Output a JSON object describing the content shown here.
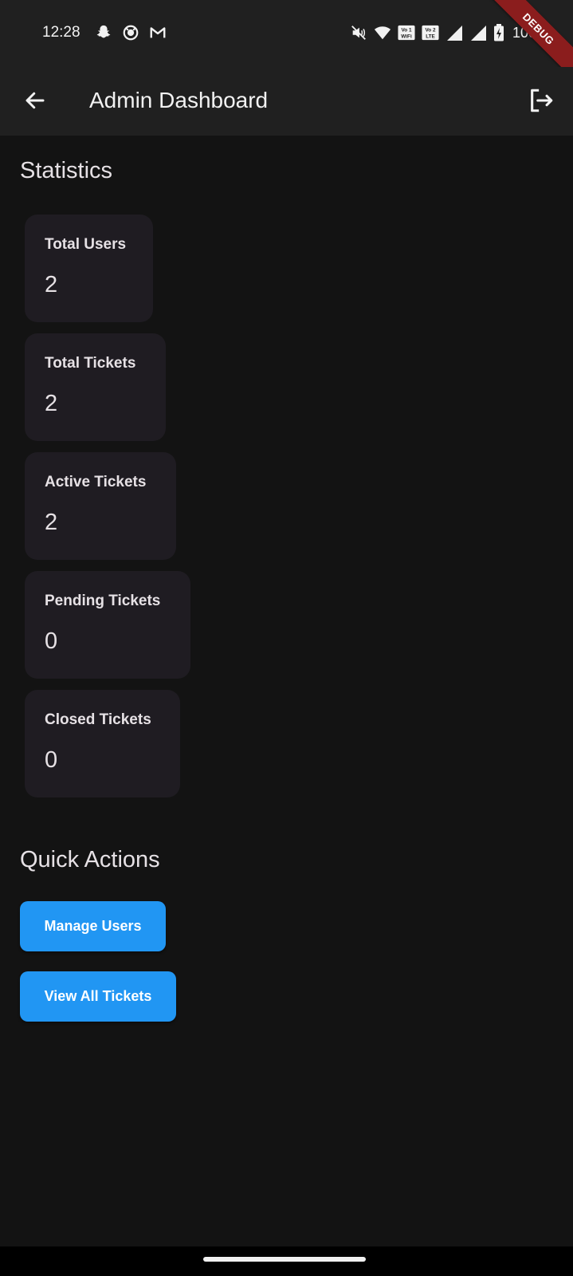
{
  "status_bar": {
    "time": "12:28",
    "battery": "100%",
    "left_icons": [
      "snapchat-icon",
      "github-icon",
      "gmail-icon"
    ],
    "right_icons": [
      "mute-icon",
      "wifi-icon",
      "vowifi-icon",
      "volte-icon",
      "signal-icon",
      "signal-icon",
      "battery-charging-icon"
    ],
    "vowifi_label": [
      "Vo 1",
      "WiFi"
    ],
    "volte_label": [
      "Vo 2",
      "LTE"
    ]
  },
  "debug_banner": "DEBUG",
  "app_bar": {
    "title": "Admin Dashboard",
    "back_icon": "arrow-back-icon",
    "logout_icon": "logout-icon"
  },
  "statistics": {
    "heading": "Statistics",
    "cards": [
      {
        "label": "Total Users",
        "value": "2"
      },
      {
        "label": "Total Tickets",
        "value": "2"
      },
      {
        "label": "Active Tickets",
        "value": "2"
      },
      {
        "label": "Pending Tickets",
        "value": "0"
      },
      {
        "label": "Closed Tickets",
        "value": "0"
      }
    ]
  },
  "quick_actions": {
    "heading": "Quick Actions",
    "buttons": [
      {
        "label": "Manage Users"
      },
      {
        "label": "View All Tickets"
      }
    ]
  },
  "colors": {
    "background": "#131313",
    "app_bar": "#202020",
    "card": "#1f1c22",
    "button": "#2196f3",
    "debug_ribbon": "#8b1d1d"
  }
}
